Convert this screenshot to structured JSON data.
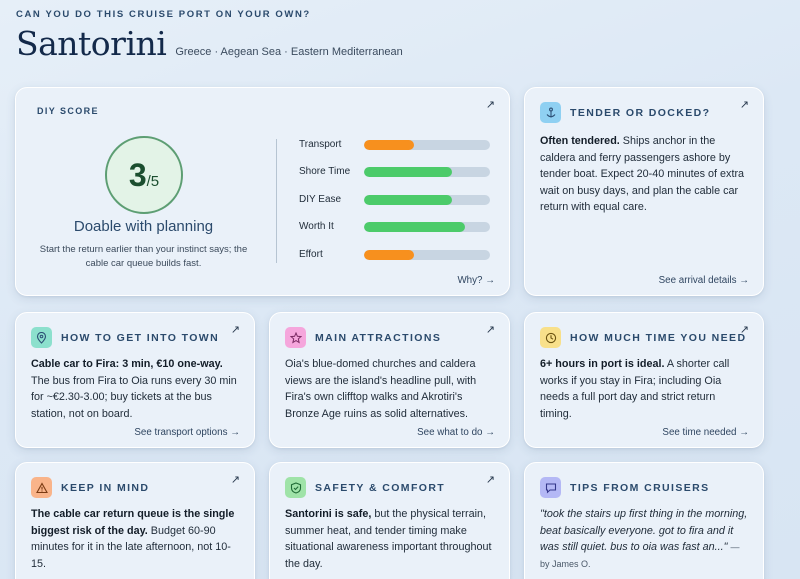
{
  "header": {
    "eyebrow": "CAN YOU DO THIS CRUISE PORT ON YOUR OWN?",
    "title": "Santorini",
    "subtitle": "Greece · Aegean Sea · Eastern Mediterranean"
  },
  "diy": {
    "label": "DIY SCORE",
    "score": "3",
    "score_den": "/5",
    "verdict": "Doable with planning",
    "note": "Start the return earlier than your instinct says; the cable car queue builds fast.",
    "link": "Why? →",
    "metrics": [
      {
        "label": "Transport",
        "value": 0.4,
        "color": "#f7901e"
      },
      {
        "label": "Shore Time",
        "value": 0.7,
        "color": "#4ccb6a"
      },
      {
        "label": "DIY Ease",
        "value": 0.7,
        "color": "#4ccb6a"
      },
      {
        "label": "Worth It",
        "value": 0.8,
        "color": "#4ccb6a"
      },
      {
        "label": "Effort",
        "value": 0.4,
        "color": "#f7901e"
      }
    ]
  },
  "cards": {
    "tender": {
      "label": "TENDER OR DOCKED?",
      "icon": "anchor-icon",
      "icon_bg": "#8fd0f2",
      "bold": "Often tendered.",
      "text": " Ships anchor in the caldera and ferry passengers ashore by tender boat. Expect 20-40 minutes of extra wait on busy days, and plan the cable car return with equal care.",
      "link": "See arrival details →"
    },
    "town": {
      "label": "HOW TO GET INTO TOWN",
      "icon": "map-pin-icon",
      "icon_bg": "#8ce0cd",
      "bold": "Cable car to Fira: 3 min, €10 one-way.",
      "text": " The bus from Fira to Oia runs every 30 min for ~€2.30-3.00; buy tickets at the bus station, not on board.",
      "link": "See transport options →"
    },
    "attractions": {
      "label": "MAIN ATTRACTIONS",
      "icon": "star-icon",
      "icon_bg": "#f5a6dc",
      "bold": "",
      "text": "Oia's blue-domed churches and caldera views are the island's headline pull, with Fira's own clifftop walks and Akrotiri's Bronze Age ruins as solid alternatives.",
      "link": "See what to do →"
    },
    "time": {
      "label": "HOW MUCH TIME YOU NEED",
      "icon": "clock-icon",
      "icon_bg": "#f8e08a",
      "bold": "6+ hours in port is ideal.",
      "text": " A shorter call works if you stay in Fira; including Oia needs a full port day and strict return timing.",
      "link": "See time needed →"
    },
    "keep": {
      "label": "KEEP IN MIND",
      "icon": "warning-icon",
      "icon_bg": "#f9b48a",
      "bold": "The cable car return queue is the single biggest risk of the day.",
      "text": " Budget 60-90 minutes for it in the late afternoon, not 10-15."
    },
    "safety": {
      "label": "SAFETY & COMFORT",
      "icon": "shield-icon",
      "icon_bg": "#9fe3a8",
      "bold": "Santorini is safe,",
      "text": " but the physical terrain, summer heat, and tender timing make situational awareness important throughout the day."
    },
    "tips": {
      "label": "TIPS FROM CRUISERS",
      "icon": "chat-icon",
      "icon_bg": "#b4b8f5",
      "quote": "\"took the stairs up first thing in the morning, beat basically everyone. got to fira and it was still quiet. bus to oia was fast an...\"",
      "author": "— by James O."
    }
  }
}
